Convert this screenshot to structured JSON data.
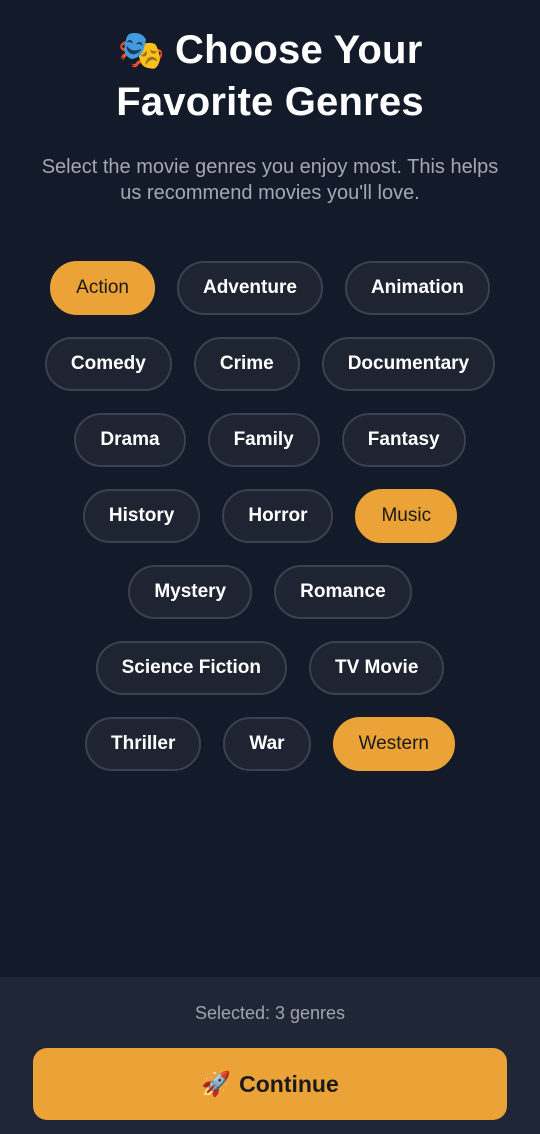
{
  "header": {
    "icon": "theater-masks-icon",
    "icon_glyph": "🎭",
    "title_line1": "Choose Your",
    "title_line2": "Favorite Genres",
    "subtitle": "Select the movie genres you enjoy most. This helps us recommend movies you'll love."
  },
  "genres": {
    "rows": [
      [
        {
          "label": "Action",
          "selected": true
        },
        {
          "label": "Adventure",
          "selected": false
        },
        {
          "label": "Animation",
          "selected": false
        }
      ],
      [
        {
          "label": "Comedy",
          "selected": false
        },
        {
          "label": "Crime",
          "selected": false
        },
        {
          "label": "Documentary",
          "selected": false
        }
      ],
      [
        {
          "label": "Drama",
          "selected": false
        },
        {
          "label": "Family",
          "selected": false
        },
        {
          "label": "Fantasy",
          "selected": false
        }
      ],
      [
        {
          "label": "History",
          "selected": false
        },
        {
          "label": "Horror",
          "selected": false
        },
        {
          "label": "Music",
          "selected": true
        }
      ],
      [
        {
          "label": "Mystery",
          "selected": false
        },
        {
          "label": "Romance",
          "selected": false
        }
      ],
      [
        {
          "label": "Science Fiction",
          "selected": false
        },
        {
          "label": "TV Movie",
          "selected": false
        }
      ],
      [
        {
          "label": "Thriller",
          "selected": false
        },
        {
          "label": "War",
          "selected": false
        },
        {
          "label": "Western",
          "selected": true
        }
      ]
    ]
  },
  "footer": {
    "selected_text": "Selected: 3 genres",
    "continue_icon": "rocket-icon",
    "continue_glyph": "🚀",
    "continue_label": "Continue"
  },
  "colors": {
    "background": "#131a2a",
    "chip_bg": "#1e2432",
    "chip_border": "#3a4150",
    "accent": "#eba236",
    "footer_bg": "#1f2736"
  }
}
